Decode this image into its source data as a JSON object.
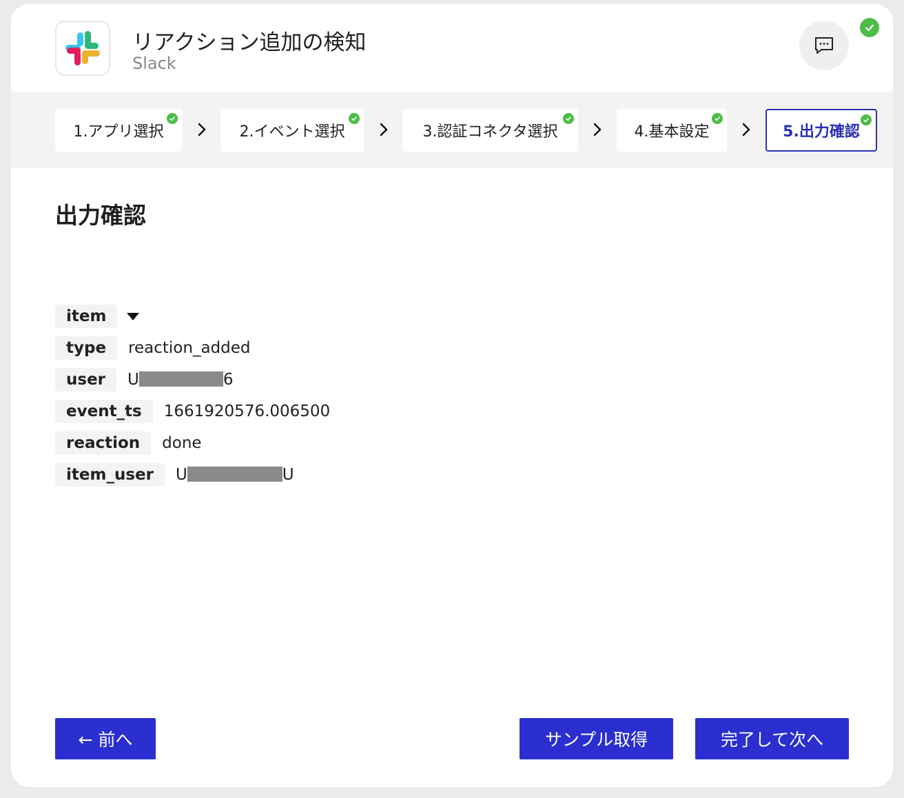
{
  "header": {
    "title": "リアクション追加の検知",
    "subtitle": "Slack",
    "logo_icon": "slack-logo",
    "chat_icon": "chat-icon",
    "status_icon": "check-icon"
  },
  "steps": [
    {
      "label": "1.アプリ選択",
      "done": true,
      "active": false
    },
    {
      "label": "2.イベント選択",
      "done": true,
      "active": false
    },
    {
      "label": "3.認証コネクタ選択",
      "done": true,
      "active": false
    },
    {
      "label": "4.基本設定",
      "done": true,
      "active": false
    },
    {
      "label": "5.出力確認",
      "done": true,
      "active": true
    }
  ],
  "main": {
    "title": "出力確認",
    "fields": [
      {
        "key": "item",
        "value": ""
      },
      {
        "key": "type",
        "value": "reaction_added"
      },
      {
        "key": "user",
        "prefix": "U",
        "suffix": "6"
      },
      {
        "key": "event_ts",
        "value": "1661920576.006500"
      },
      {
        "key": "reaction",
        "value": "done"
      },
      {
        "key": "item_user",
        "prefix": "U",
        "suffix": "U"
      }
    ]
  },
  "footer": {
    "back_label": "← 前へ",
    "sample_label": "サンプル取得",
    "next_label": "完了して次へ"
  },
  "colors": {
    "primary": "#2b2fcf",
    "success": "#4cbc45",
    "panel": "#f3f3f3"
  }
}
